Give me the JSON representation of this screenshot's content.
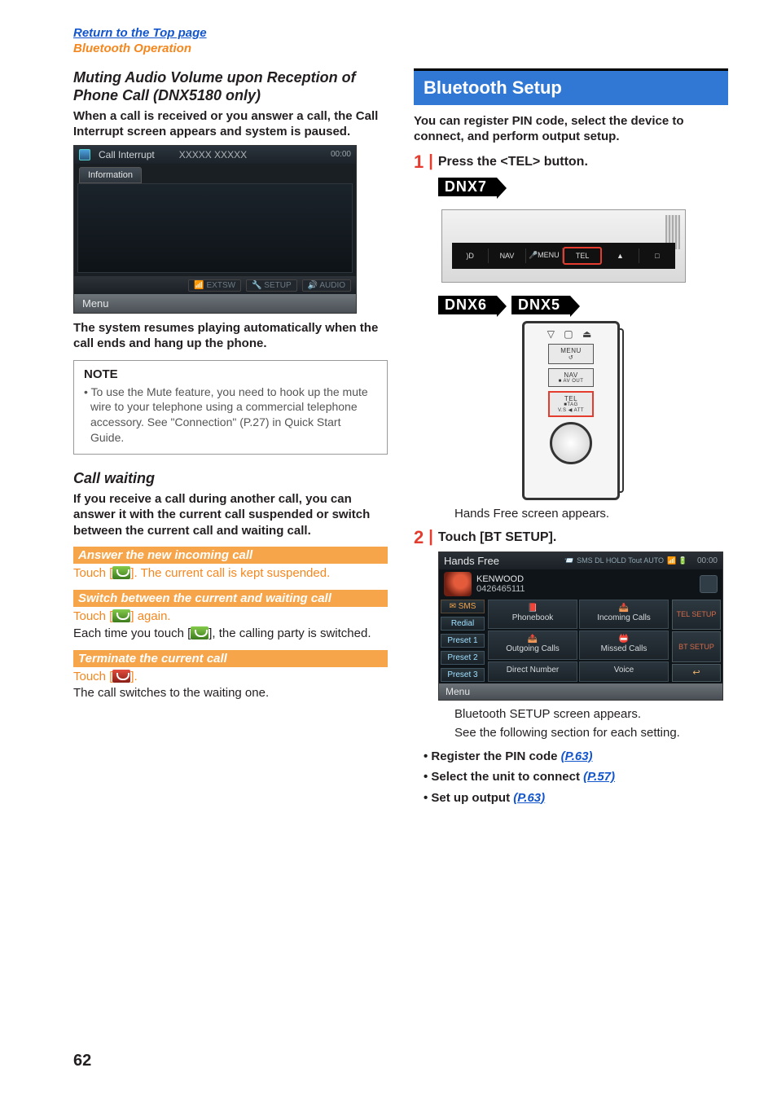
{
  "topLinks": {
    "return": "Return to the Top page",
    "section": "Bluetooth Operation"
  },
  "left": {
    "mutingHeading": "Muting Audio Volume upon Reception of Phone Call (DNX5180 only)",
    "mutingIntro": "When a call is received or you answer a call, the Call Interrupt screen appears and system is paused.",
    "screenshot1": {
      "title": "Call Interrupt",
      "subtitle": "XXXXX XXXXX",
      "clock": "00:00",
      "tab": "Information",
      "bottomBtns": [
        "EXTSW",
        "SETUP",
        "AUDIO"
      ],
      "menu": "Menu"
    },
    "resumeText": "The system resumes playing automatically when the call ends and hang up the phone.",
    "note": {
      "title": "NOTE",
      "body": "• To use the Mute feature, you need to hook up the mute wire to your telephone using a commercial telephone accessory. See \"Connection\" (P.27) in Quick Start Guide."
    },
    "callWaiting": {
      "heading": "Call waiting",
      "intro": "If you receive a call during another call, you can answer it with the current call suspended or switch between the current call and waiting call.",
      "answer": {
        "header": "Answer the new incoming call",
        "pre": "Touch [",
        "post": "]. The current call is kept suspended."
      },
      "switch": {
        "header": "Switch between the current and waiting call",
        "line1pre": "Touch [",
        "line1post": "] again.",
        "line2pre": "Each time you touch [",
        "line2post": "], the calling party is switched."
      },
      "terminate": {
        "header": "Terminate the current call",
        "line1pre": "Touch [",
        "line1post": "].",
        "line2": "The call switches to the waiting one."
      }
    }
  },
  "right": {
    "header": "Bluetooth Setup",
    "intro": "You can register PIN code, select the device to connect, and perform output setup.",
    "step1": {
      "num": "1",
      "text": "Press the <TEL> button.",
      "badge7": "DNX7",
      "badge6": "DNX6",
      "badge5": "DNX5",
      "panel": {
        "cells": [
          ")D",
          "NAV",
          "MENU",
          "TEL",
          "▲",
          "□"
        ]
      },
      "vertDevice": {
        "topIcons": "▽ ▢ ⏏",
        "menu": "MENU",
        "nav": "NAV",
        "navSub": "■ AV OUT",
        "tel": "TEL",
        "telSub": "■TAG"
      },
      "caption": "Hands Free screen appears."
    },
    "step2": {
      "num": "2",
      "text": "Touch [BT SETUP].",
      "hf": {
        "title": "Hands Free",
        "topIconsText": "SMS DL HOLD Tout AUTO",
        "clock": "00:00",
        "kenwood": "KENWOOD",
        "number": "0426465111",
        "sms": "SMS",
        "redial": "Redial",
        "preset1": "Preset 1",
        "preset2": "Preset 2",
        "preset3": "Preset 3",
        "cells": {
          "phonebook": "Phonebook",
          "incoming": "Incoming Calls",
          "outgoing": "Outgoing Calls",
          "missed": "Missed Calls",
          "direct": "Direct Number",
          "voice": "Voice"
        },
        "telSetup": "TEL SETUP",
        "btSetup": "BT SETUP",
        "menu": "Menu"
      },
      "caption1": "Bluetooth SETUP screen appears.",
      "caption2": "See the following section for each setting."
    },
    "bullets": [
      {
        "label": "Register the PIN code ",
        "link": "(P.63)"
      },
      {
        "label": "Select the unit to connect ",
        "link": "(P.57)"
      },
      {
        "label": "Set up output ",
        "link": "(P.63)"
      }
    ]
  },
  "pageNumber": "62"
}
